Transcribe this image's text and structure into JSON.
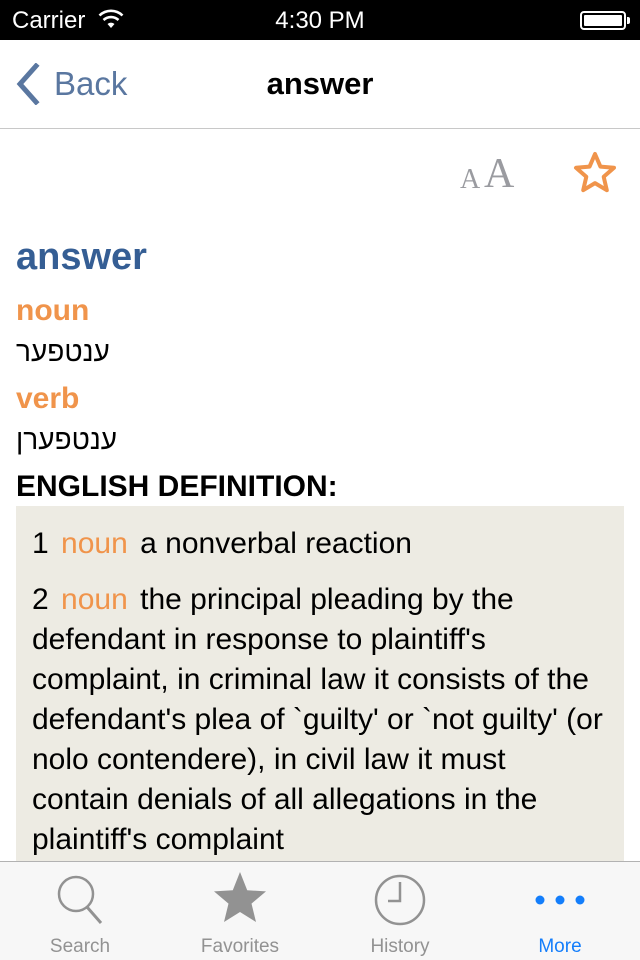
{
  "status_bar": {
    "carrier": "Carrier",
    "time": "4:30 PM",
    "wifi_icon": "wifi-icon",
    "battery_icon": "battery-full-icon"
  },
  "nav_bar": {
    "back_label": "Back",
    "title": "answer"
  },
  "toolbar": {
    "font_size_small": "A",
    "font_size_large": "A",
    "favorite_icon": "star-outline-icon"
  },
  "entry": {
    "headword": "answer",
    "senses": [
      {
        "pos": "noun",
        "translation": "ענטפער"
      },
      {
        "pos": "verb",
        "translation": "ענטפערן"
      }
    ],
    "definition_heading": "ENGLISH DEFINITION:",
    "definitions": [
      {
        "num": "1",
        "pos": "noun",
        "text": "a nonverbal reaction"
      },
      {
        "num": "2",
        "pos": "noun",
        "text": "the principal pleading by the defendant in response to plaintiff's complaint, in criminal law it consists of the defendant's plea of `guilty' or `not guilty' (or nolo contendere), in civil law it must contain denials of all allegations in the plaintiff's complaint"
      }
    ]
  },
  "tab_bar": {
    "tabs": [
      {
        "label": "Search",
        "icon": "search-icon",
        "active": false
      },
      {
        "label": "Favorites",
        "icon": "star-icon",
        "active": false
      },
      {
        "label": "History",
        "icon": "clock-icon",
        "active": false
      },
      {
        "label": "More",
        "icon": "more-icon",
        "active": true
      }
    ]
  },
  "colors": {
    "headword": "#355e94",
    "pos": "#f0944b",
    "back": "#5a77a0",
    "favorite": "#f0944b",
    "definition_bg": "#edebe3",
    "tab_active": "#147efb",
    "tab_inactive": "#929292"
  }
}
